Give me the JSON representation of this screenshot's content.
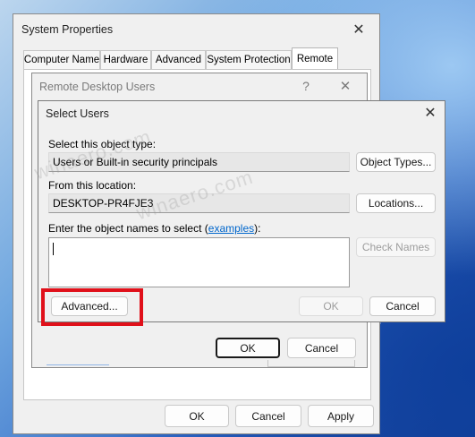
{
  "system_properties": {
    "title": "System Properties",
    "tabs": [
      {
        "label": "Computer Name"
      },
      {
        "label": "Hardware"
      },
      {
        "label": "Advanced"
      },
      {
        "label": "System Protection"
      },
      {
        "label": "Remote"
      }
    ],
    "ok_label": "OK",
    "cancel_label": "Cancel",
    "apply_label": "Apply"
  },
  "remote_desktop_users": {
    "title": "Remote Desktop Users",
    "help_glyph": "?",
    "ok_label": "OK",
    "cancel_label": "Cancel"
  },
  "select_users": {
    "title": "Select Users",
    "object_type_label": "Select this object type:",
    "object_type_value": "Users or Built-in security principals",
    "object_types_button": "Object Types...",
    "location_label": "From this location:",
    "location_value": "DESKTOP-PR4FJE3",
    "locations_button": "Locations...",
    "names_label_prefix": "Enter the object names to select (",
    "names_label_link": "examples",
    "names_label_suffix": "):",
    "names_value": "",
    "check_names_button": "Check Names",
    "advanced_button": "Advanced...",
    "ok_label": "OK",
    "cancel_label": "Cancel"
  },
  "watermark": "winaero.com",
  "colors": {
    "highlight_red": "#e0101a",
    "link_blue": "#0066cc",
    "desktop_blue": "#2c64c4"
  }
}
